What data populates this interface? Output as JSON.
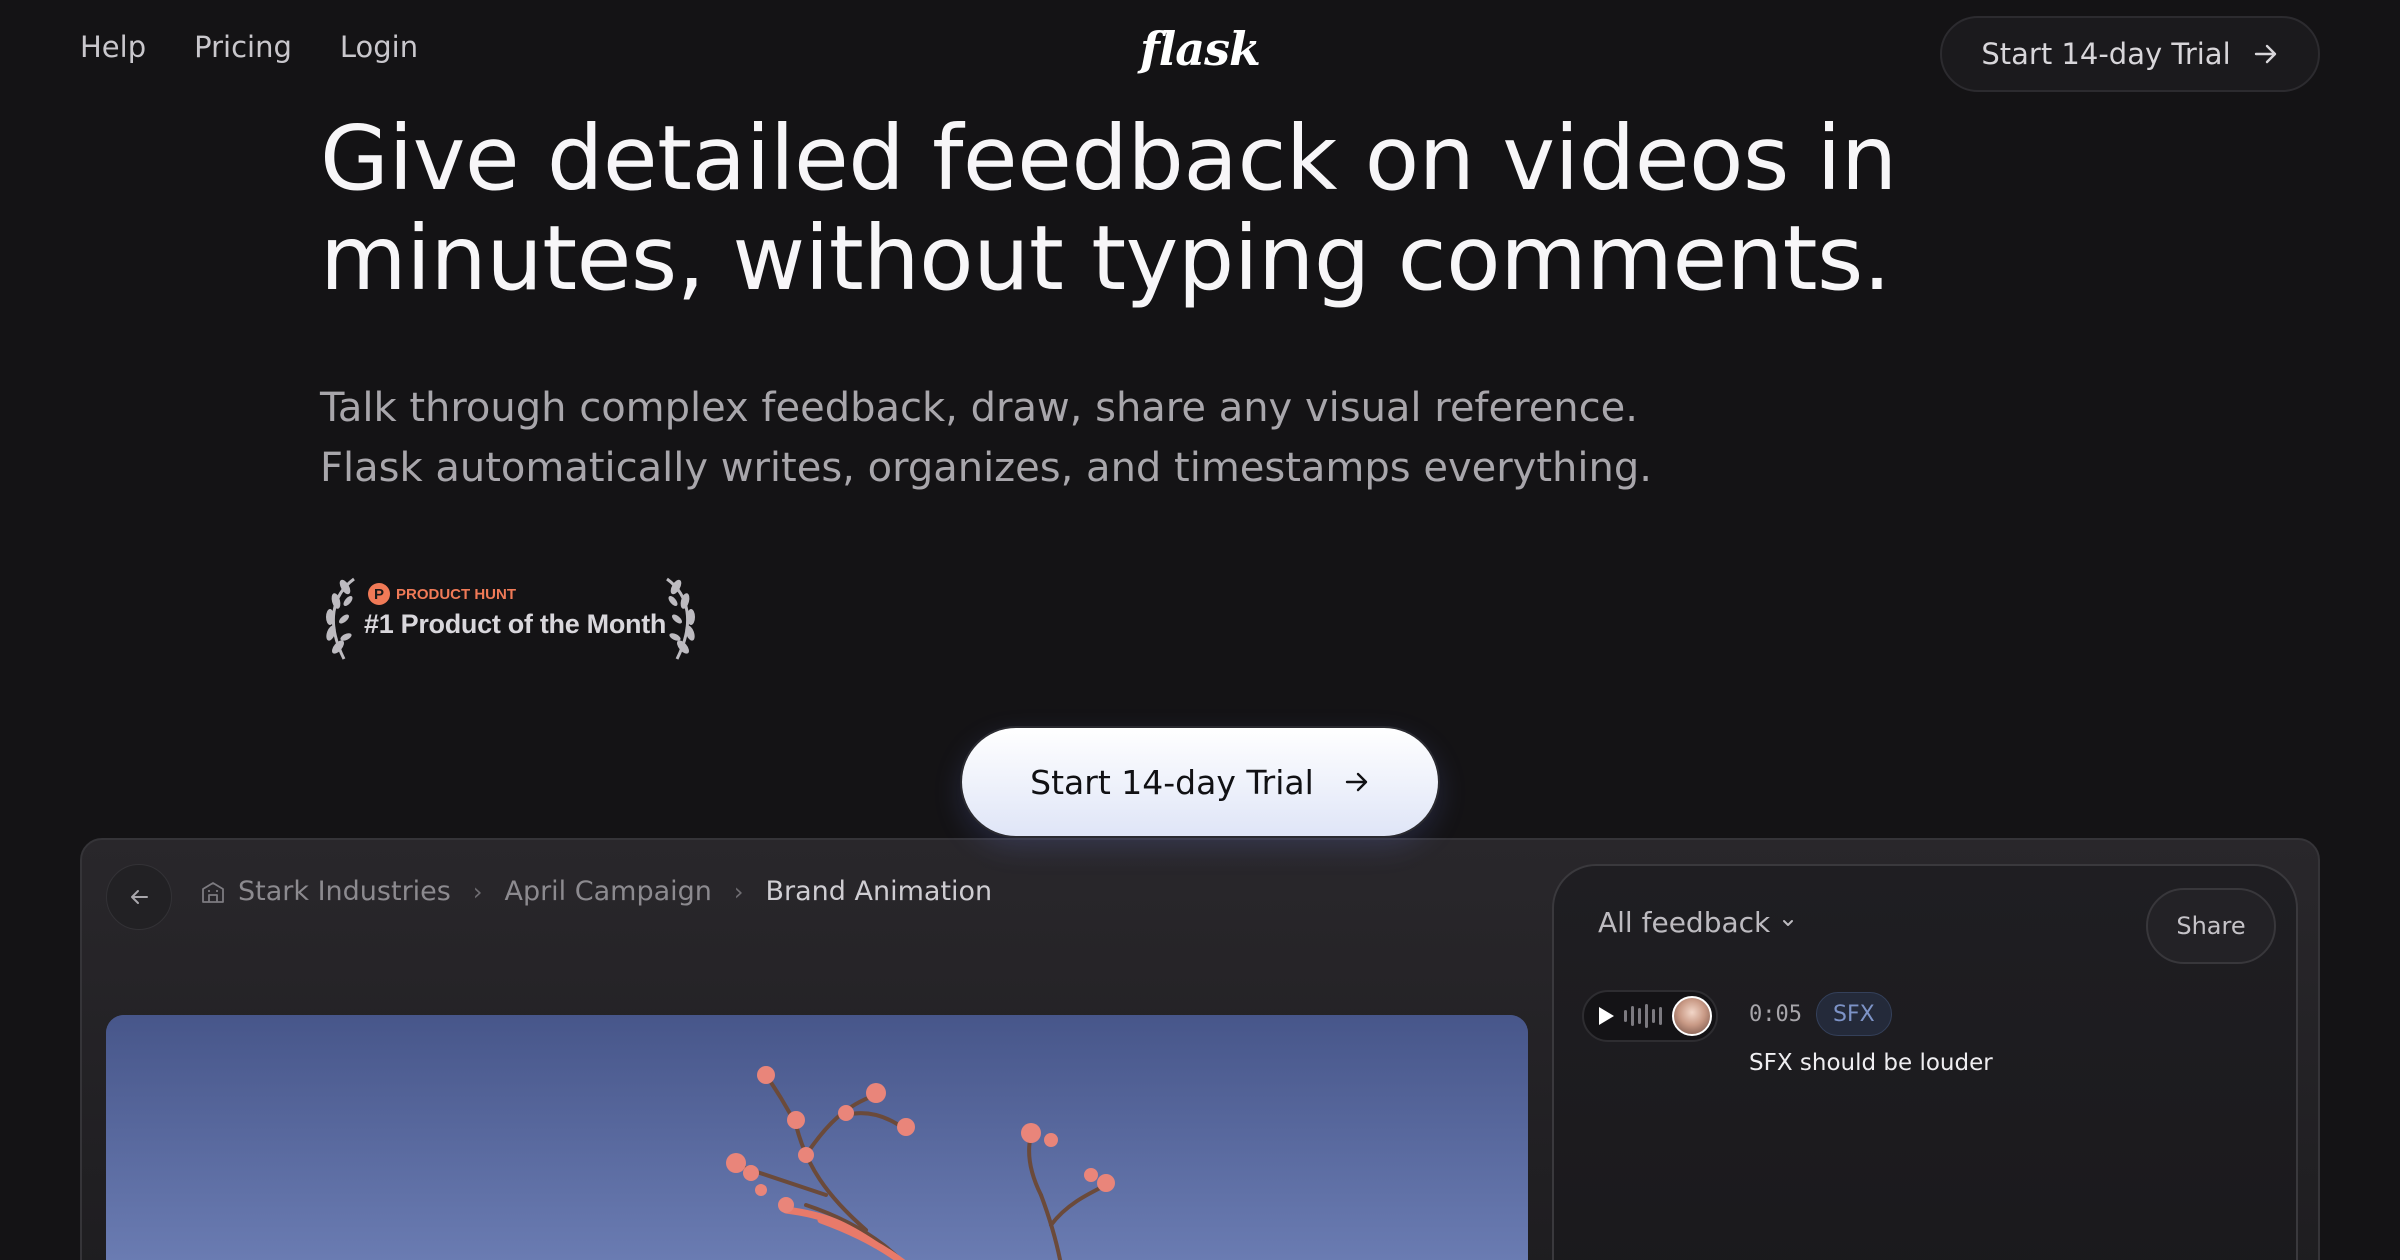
{
  "nav": {
    "links": [
      "Help",
      "Pricing",
      "Login"
    ],
    "logo": "flask",
    "cta_label": "Start 14-day Trial"
  },
  "hero": {
    "title_line1": "Give detailed feedback on videos in",
    "title_line2": "minutes, without typing comments.",
    "subtitle_line1": "Talk through complex feedback, draw, share any visual reference.",
    "subtitle_line2": "Flask automatically writes, organizes, and timestamps everything.",
    "badge": {
      "source": "PRODUCT HUNT",
      "logo_letter": "P",
      "title": "#1 Product of the Month",
      "accent": "#f07a57"
    },
    "cta_label": "Start 14-day Trial"
  },
  "app": {
    "breadcrumb": [
      "Stark Industries",
      "April Campaign",
      "Brand Animation"
    ],
    "panel": {
      "filter_label": "All feedback",
      "share_label": "Share",
      "feedback": {
        "timestamp": "0:05",
        "tag": "SFX",
        "text": "SFX should be louder"
      }
    }
  }
}
